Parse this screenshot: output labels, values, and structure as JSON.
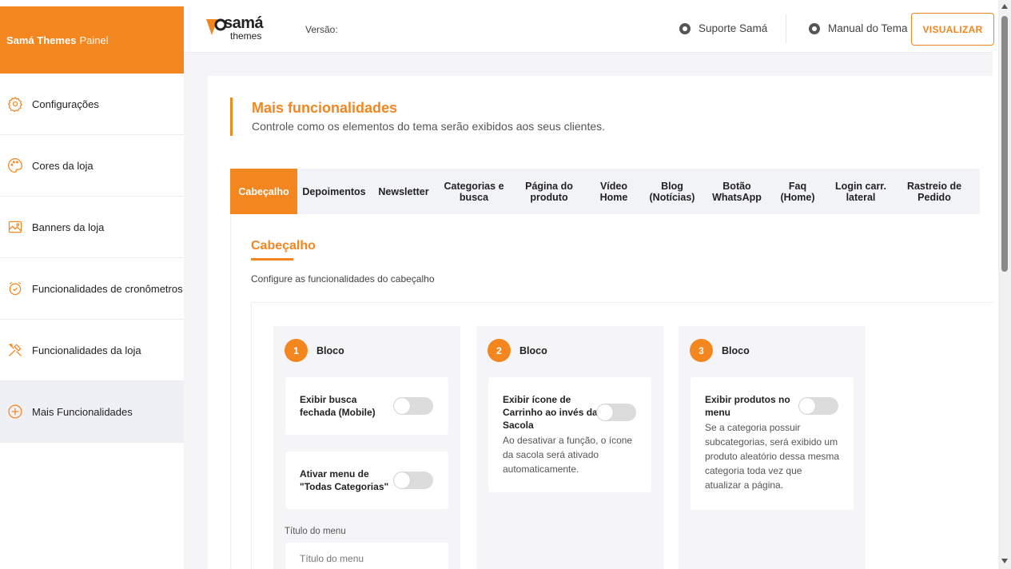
{
  "sidebar": {
    "brand_bold": "Samá Themes",
    "brand_thin": "Painel",
    "items": [
      {
        "label": "Configurações"
      },
      {
        "label": "Cores da loja"
      },
      {
        "label": "Banners da loja"
      },
      {
        "label": "Funcionalidades de cronômetros"
      },
      {
        "label": "Funcionalidades da loja"
      },
      {
        "label": "Mais Funcionalidades"
      }
    ]
  },
  "topbar": {
    "logo_line1": "samá",
    "logo_line2": "themes",
    "version_label": "Versão:",
    "support_link": "Suporte Samá",
    "manual_link": "Manual do Tema",
    "visualizar_button": "VISUALIZAR"
  },
  "header": {
    "title": "Mais funcionalidades",
    "subtitle": "Controle como os elementos do tema serão exibidos aos seus clientes."
  },
  "tabs": [
    {
      "label": "Cabeçalho"
    },
    {
      "label": "Depoimentos"
    },
    {
      "label": "Newsletter"
    },
    {
      "label": "Categorias e busca"
    },
    {
      "label": "Página do produto"
    },
    {
      "label": "Vídeo Home"
    },
    {
      "label": "Blog (Notícias)"
    },
    {
      "label": "Botão WhatsApp"
    },
    {
      "label": "Faq (Home)"
    },
    {
      "label": "Login carr. lateral"
    },
    {
      "label": "Rastreio de Pedido"
    }
  ],
  "panel": {
    "title": "Cabeçalho",
    "description": "Configure as funcionalidades do cabeçalho",
    "blocks": [
      {
        "number": "1",
        "label": "Bloco",
        "options": [
          {
            "title": "Exibir busca fechada (Mobile)",
            "enabled": false
          },
          {
            "title": "Ativar menu de \"Todas Categorias\"",
            "enabled": false
          }
        ],
        "field_label": "Título do menu",
        "field_placeholder": "Título do menu"
      },
      {
        "number": "2",
        "label": "Bloco",
        "options": [
          {
            "title": "Exibir ícone de Carrinho ao invés da Sacola",
            "description": "Ao desativar a função, o ícone da sacola será ativado automaticamente.",
            "enabled": false
          }
        ]
      },
      {
        "number": "3",
        "label": "Bloco",
        "options": [
          {
            "title": "Exibir produtos no menu",
            "description": "Se a categoria possuir subcategorias, será exibido um produto aleatório dessa mesma categoria toda vez que atualizar a página.",
            "enabled": false
          }
        ]
      }
    ]
  },
  "colors": {
    "accent": "#f4861f",
    "active_nav_bg": "#eef0f5",
    "toggle_off": "#dcdcdc"
  }
}
